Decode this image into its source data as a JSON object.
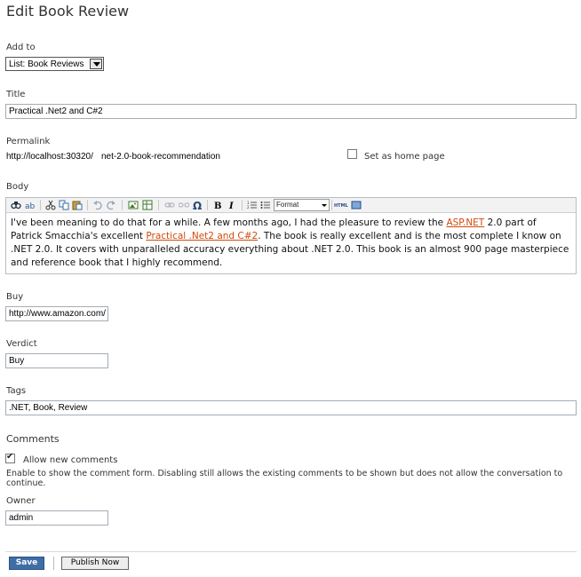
{
  "page_title": "Edit Book Review",
  "add_to": {
    "label": "Add to",
    "selected": "List: Book Reviews"
  },
  "title_field": {
    "label": "Title",
    "value": "Practical .Net2 and C#2"
  },
  "permalink": {
    "label": "Permalink",
    "prefix": "http://localhost:30320/",
    "value": "net-2.0-book-recommendation",
    "home_page_label": "Set as home page",
    "home_page_checked": false
  },
  "body": {
    "label": "Body",
    "format_select": "Format",
    "text_parts": [
      "I've been meaning to do that for a while. A few months ago, I had the pleasure to review the ",
      "ASP.NET",
      " 2.0 part of Patrick Smacchia's excellent ",
      "Practical .Net2 and C#2",
      ". The book is really excellent and is the most complete I know on .NET 2.0. It covers with unparalleled accuracy everything about .NET 2.0. This book is an almost 900 page masterpiece and reference book that I highly recommend."
    ],
    "toolbar_icons": [
      "find-icon",
      "replace-icon",
      "cut-icon",
      "copy-icon",
      "paste-icon",
      "undo-icon",
      "redo-icon",
      "image-icon",
      "table-icon",
      "link-icon",
      "unlink-icon",
      "omega-icon",
      "bold-icon",
      "italic-icon",
      "ordered-list-icon",
      "unordered-list-icon",
      "html-icon",
      "fullscreen-icon"
    ]
  },
  "buy": {
    "label": "Buy",
    "value": "http://www.amazon.com/"
  },
  "verdict": {
    "label": "Verdict",
    "value": "Buy"
  },
  "tags": {
    "label": "Tags",
    "value": ".NET, Book, Review"
  },
  "comments": {
    "heading": "Comments",
    "allow_label": "Allow new comments",
    "allow_checked": true,
    "help": "Enable to show the comment form. Disabling still allows the existing comments to be shown but does not allow the conversation to continue."
  },
  "owner": {
    "label": "Owner",
    "value": "admin"
  },
  "actions": {
    "save": "Save",
    "publish": "Publish Now"
  },
  "colors": {
    "link": "#d04a0b",
    "save_button": "#3f6da6"
  }
}
